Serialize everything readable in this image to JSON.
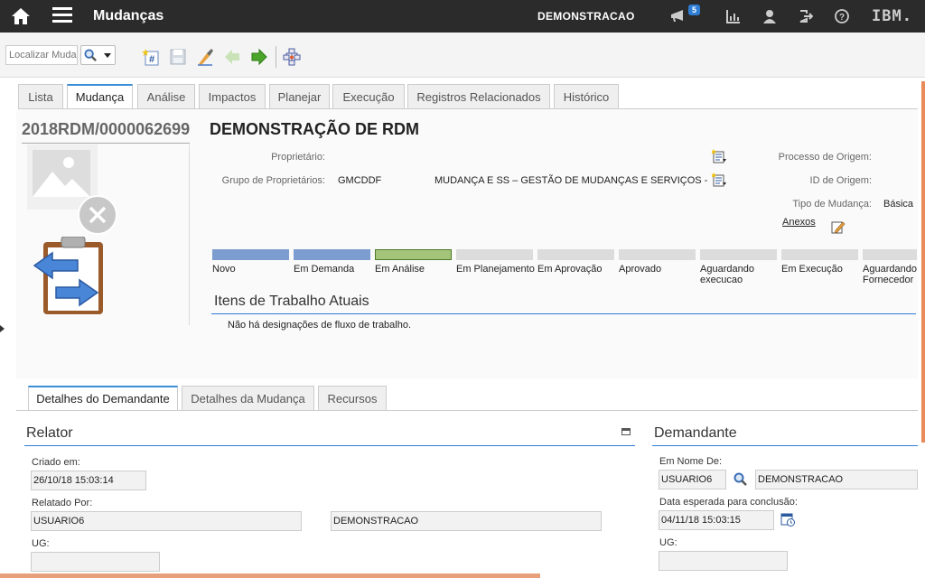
{
  "topbar": {
    "app_title": "Mudanças",
    "user": "DEMONSTRACAO",
    "notification_count": "5",
    "brand": "IBM."
  },
  "toolbar": {
    "search_placeholder": "Localizar Muda"
  },
  "tabs": [
    {
      "label": "Lista"
    },
    {
      "label": "Mudança"
    },
    {
      "label": "Análise"
    },
    {
      "label": "Impactos"
    },
    {
      "label": "Planejar"
    },
    {
      "label": "Execução"
    },
    {
      "label": "Registros Relacionados"
    },
    {
      "label": "Histórico"
    }
  ],
  "record": {
    "id": "2018RDM/0000062699",
    "title": "DEMONSTRAÇÃO DE RDM",
    "proprietario_label": "Proprietário:",
    "proprietario_value": "",
    "grupo_label": "Grupo de Proprietários:",
    "grupo_value": "GMCDDF",
    "grupo_desc": "MUDANÇA E SS – GESTÃO DE MUDANÇAS E SERVIÇOS -",
    "processo_label": "Processo de Origem:",
    "id_origem_label": "ID de Origem:",
    "tipo_label": "Tipo de Mudança:",
    "tipo_value": "Básica",
    "anexos": "Anexos"
  },
  "stages": [
    {
      "label": "Novo",
      "color": "#7d9ccf"
    },
    {
      "label": "Em Demanda",
      "color": "#7d9ccf"
    },
    {
      "label": "Em Análise",
      "color": "#a4c47a"
    },
    {
      "label": "Em Planejamento",
      "color": "#dcdcdc"
    },
    {
      "label": "Em Aprovação",
      "color": "#dcdcdc"
    },
    {
      "label": "Aprovado",
      "color": "#dcdcdc"
    },
    {
      "label": "Aguardando execucao",
      "color": "#dcdcdc"
    },
    {
      "label": "Em Execução",
      "color": "#dcdcdc"
    },
    {
      "label": "Aguardando Fornecedor",
      "color": "#dcdcdc"
    }
  ],
  "itens": {
    "title": "Itens de Trabalho Atuais",
    "empty": "Não há designações de fluxo de trabalho."
  },
  "subtabs": [
    {
      "label": "Detalhes do Demandante"
    },
    {
      "label": "Detalhes da Mudança"
    },
    {
      "label": "Recursos"
    }
  ],
  "relator": {
    "title": "Relator",
    "criado_label": "Criado em:",
    "criado_value": "26/10/18 15:03:14",
    "relatado_label": "Relatado Por:",
    "relatado_value": "USUARIO6",
    "relatado_name": "DEMONSTRACAO",
    "ug_label": "UG:",
    "ug_value": ""
  },
  "demandante": {
    "title": "Demandante",
    "nome_label": "Em Nome De:",
    "nome_value": "USUARIO6",
    "nome_name": "DEMONSTRACAO",
    "data_label": "Data esperada para conclusão:",
    "data_value": "04/11/18 15:03:15",
    "ug_label": "UG:",
    "ug_value": ""
  }
}
